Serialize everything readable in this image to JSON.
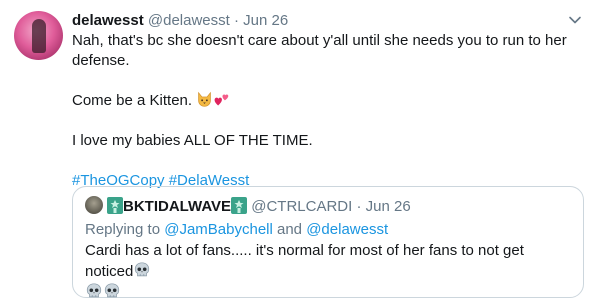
{
  "tweet": {
    "display_name": "delawesst",
    "handle": "@delawesst",
    "dot": "·",
    "date": "Jun 26",
    "line1": "Nah, that's bc she doesn't care about y'all until she needs you to run to her defense.",
    "line2": "Come be a Kitten.",
    "line3": "I love my babies ALL OF THE TIME.",
    "hashtags": [
      "#TheOGCopy",
      "#DelaWesst"
    ],
    "icons": {
      "menu": "chevron-down-icon",
      "cat": "cat-face-emoji-icon",
      "hearts": "two-hearts-emoji-icon"
    }
  },
  "quote": {
    "display_name": "BKTIDALWAVE",
    "handle": "@CTRLCARDI",
    "dot": "·",
    "date": "Jun 26",
    "replying_prefix": "Replying to",
    "reply_user_1": "@JamBabychell",
    "reply_and": "and",
    "reply_user_2": "@delawesst",
    "text": "Cardi has a lot of fans..... it's normal for most of her fans to not get noticed",
    "icons": {
      "statue": "statue-of-liberty-emoji-icon",
      "skull": "skull-emoji-icon"
    }
  },
  "colors": {
    "link": "#1b95e0",
    "secondary": "#657786",
    "border": "#ccd6dd",
    "text": "#14171a"
  }
}
